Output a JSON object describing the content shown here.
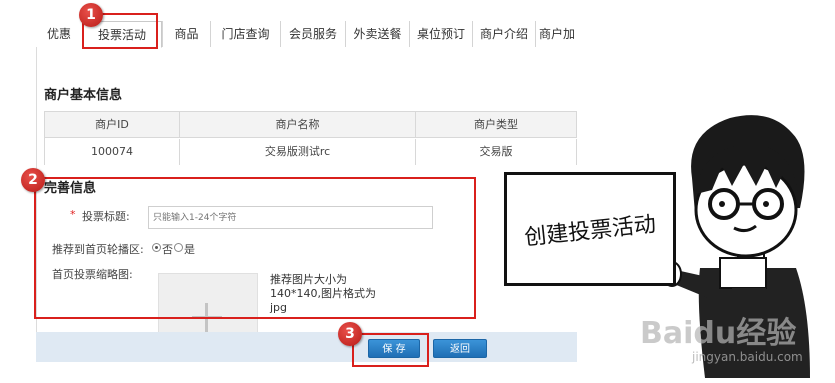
{
  "tabs": [
    "优惠",
    "投票活动",
    "商品",
    "门店查询",
    "会员服务",
    "外卖送餐",
    "桌位预订",
    "商户介绍",
    "商户加"
  ],
  "active_tab_index": 1,
  "merchant_section": {
    "title": "商户基本信息",
    "columns": [
      "商户ID",
      "商户名称",
      "商户类型"
    ],
    "row": [
      "100074",
      "交易版测试rc",
      "交易版"
    ]
  },
  "form_section": {
    "title": "完善信息",
    "vote_title_label": "投票标题:",
    "required_mark": "*",
    "vote_title_placeholder": "只能输入1-24个字符",
    "recommend_label": "推荐到首页轮播区:",
    "radio_no": "否",
    "radio_yes": "是",
    "radio_selected": "否",
    "thumbnail_label": "首页投票缩略图:",
    "thumbnail_hint": "推荐图片大小为140*140,图片格式为jpg"
  },
  "buttons": {
    "save": "保 存",
    "back": "返回"
  },
  "annotations": {
    "step1": "1",
    "step2": "2",
    "step3": "3",
    "whiteboard_text": "创建投票活动"
  },
  "watermark": {
    "logo": "Baidu经验",
    "url": "jingyan.baidu.com"
  },
  "colors": {
    "annotation_red": "#d9201c",
    "button_blue": "#2a80c6",
    "footer_bg": "#dfe9f3"
  }
}
